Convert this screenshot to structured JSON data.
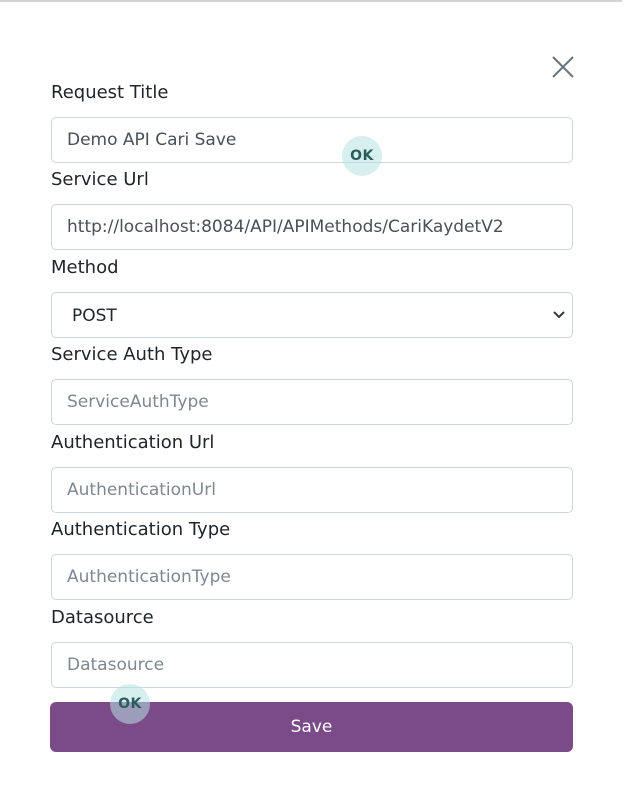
{
  "form": {
    "close_icon": "close-icon",
    "request_title": {
      "label": "Request Title",
      "value": "Demo API Cari Save"
    },
    "service_url": {
      "label": "Service Url",
      "value": "http://localhost:8084/API/APIMethods/CariKaydetV2"
    },
    "method": {
      "label": "Method",
      "selected": "POST"
    },
    "service_auth_type": {
      "label": "Service Auth Type",
      "placeholder": "ServiceAuthType"
    },
    "authentication_url": {
      "label": "Authentication Url",
      "placeholder": "AuthenticationUrl"
    },
    "authentication_type": {
      "label": "Authentication Type",
      "placeholder": "AuthenticationType"
    },
    "datasource": {
      "label": "Datasource",
      "placeholder": "Datasource"
    },
    "save_label": "Save"
  },
  "badges": {
    "ok_top": "OK",
    "ok_bottom": "OK"
  },
  "colors": {
    "primary": "#7b4b89",
    "badge": "#b6e2e2",
    "border": "#ced4da"
  }
}
